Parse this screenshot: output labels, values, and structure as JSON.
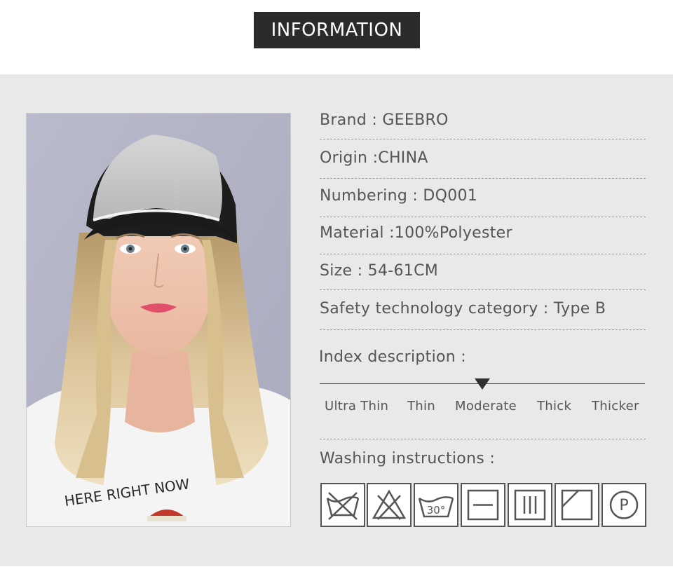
{
  "header": {
    "title": "INFORMATION"
  },
  "specs": [
    {
      "label": "Brand : GEEBRO"
    },
    {
      "label": "Origin :CHINA"
    },
    {
      "label": "Numbering : DQ001"
    },
    {
      "label": "Material :100%Polyester"
    },
    {
      "label": "Size : 54-61CM"
    },
    {
      "label": "Safety technology category : Type B"
    }
  ],
  "index": {
    "title": "Index description :",
    "scale": [
      "Ultra Thin",
      "Thin",
      "Moderate",
      "Thick",
      "Thicker"
    ],
    "selected": "Moderate"
  },
  "washing": {
    "title": "Washing instructions :",
    "icons": [
      {
        "name": "do-not-wash-icon"
      },
      {
        "name": "do-not-bleach-icon"
      },
      {
        "name": "wash-30-icon",
        "text": "30°"
      },
      {
        "name": "dry-flat-icon"
      },
      {
        "name": "drip-dry-icon"
      },
      {
        "name": "dry-in-shade-icon"
      },
      {
        "name": "dry-clean-p-icon",
        "text": "P"
      }
    ]
  },
  "photo": {
    "shirt_text": "HERE RIGHT NOW"
  },
  "colors": {
    "badge": "#2b2b2b",
    "panel": "#e9e9e9",
    "text": "#555555"
  }
}
